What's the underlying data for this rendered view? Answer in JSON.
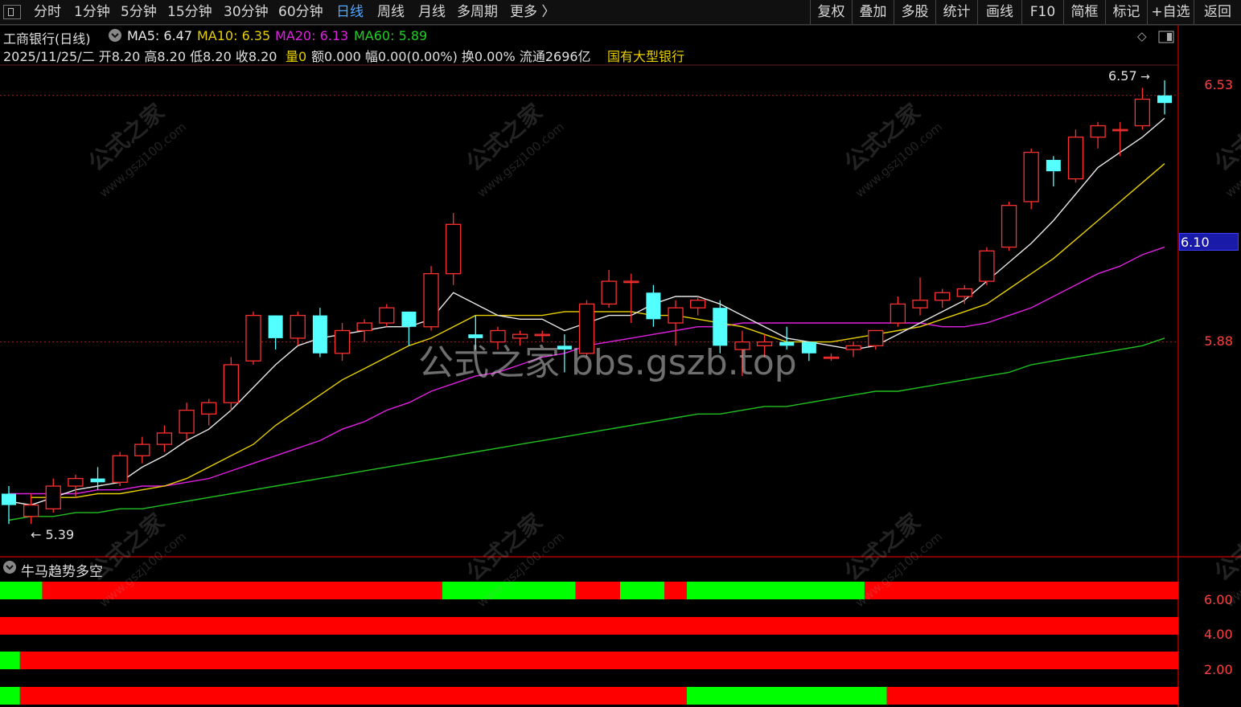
{
  "toolbar": {
    "left_items": [
      "分时",
      "1分钟",
      "5分钟",
      "15分钟",
      "30分钟",
      "60分钟",
      "日线",
      "周线",
      "月线",
      "多周期",
      "更多 〉"
    ],
    "active_index": 6,
    "right_items": [
      "复权",
      "叠加",
      "多股",
      "统计",
      "画线",
      "F10",
      "简框",
      "标记",
      "+自选",
      "返回"
    ]
  },
  "header": {
    "stock_name": "工商银行(日线)",
    "ma5": "MA5: 6.47",
    "ma10": "MA10: 6.35",
    "ma20": "MA20: 6.13",
    "ma60": "MA60: 5.89",
    "quote_line": "2025/11/25/二 开8.20 高8.20 低8.20 收8.20",
    "volume": "量0",
    "amount_etc": "额0.000 幅0.00(0.00%) 换0.00% 流通2696亿",
    "sector": "国有大型银行"
  },
  "colors": {
    "up": "#ff3030",
    "down": "#54ffff",
    "ma5": "#e8e8e8",
    "ma10": "#e8d000",
    "ma20": "#e020e0",
    "ma60": "#20c020",
    "accent": "#4fa8ff",
    "ind_red": "#ff0000",
    "ind_green": "#00ff00"
  },
  "price_axis": {
    "labels": [
      "6.53",
      "6.10",
      "5.88"
    ],
    "current_price_tag": "6.10",
    "high_marker": "6.57",
    "low_marker": "5.39"
  },
  "chart_data": {
    "type": "candlestick",
    "ylim": [
      5.32,
      6.61
    ],
    "candles": [
      [
        5.48,
        5.45,
        5.5,
        5.4
      ],
      [
        5.42,
        5.45,
        5.48,
        5.4
      ],
      [
        5.44,
        5.5,
        5.52,
        5.43
      ],
      [
        5.5,
        5.52,
        5.53,
        5.47
      ],
      [
        5.52,
        5.51,
        5.55,
        5.49
      ],
      [
        5.51,
        5.58,
        5.59,
        5.5
      ],
      [
        5.58,
        5.61,
        5.63,
        5.56
      ],
      [
        5.61,
        5.64,
        5.66,
        5.59
      ],
      [
        5.64,
        5.7,
        5.72,
        5.62
      ],
      [
        5.69,
        5.72,
        5.73,
        5.66
      ],
      [
        5.72,
        5.82,
        5.84,
        5.7
      ],
      [
        5.83,
        5.95,
        5.96,
        5.82
      ],
      [
        5.95,
        5.89,
        5.95,
        5.86
      ],
      [
        5.89,
        5.95,
        5.96,
        5.87
      ],
      [
        5.95,
        5.85,
        5.97,
        5.84
      ],
      [
        5.85,
        5.91,
        5.93,
        5.83
      ],
      [
        5.91,
        5.93,
        5.94,
        5.88
      ],
      [
        5.93,
        5.97,
        5.98,
        5.92
      ],
      [
        5.96,
        5.92,
        5.96,
        5.87
      ],
      [
        5.92,
        6.06,
        6.08,
        5.91
      ],
      [
        6.06,
        6.19,
        6.22,
        6.03
      ],
      [
        5.9,
        5.89,
        5.95,
        5.86
      ],
      [
        5.88,
        5.91,
        5.92,
        5.86
      ],
      [
        5.89,
        5.9,
        5.91,
        5.87
      ],
      [
        5.9,
        5.9,
        5.91,
        5.88
      ],
      [
        5.87,
        5.86,
        5.9,
        5.8
      ],
      [
        5.85,
        5.98,
        5.99,
        5.84
      ],
      [
        5.98,
        6.04,
        6.07,
        5.97
      ],
      [
        6.04,
        6.04,
        6.06,
        5.93
      ],
      [
        6.01,
        5.94,
        6.03,
        5.92
      ],
      [
        5.93,
        5.97,
        5.99,
        5.87
      ],
      [
        5.97,
        5.99,
        6.0,
        5.95
      ],
      [
        5.97,
        5.87,
        5.99,
        5.85
      ],
      [
        5.86,
        5.88,
        5.91,
        5.79
      ],
      [
        5.87,
        5.88,
        5.9,
        5.84
      ],
      [
        5.88,
        5.87,
        5.92,
        5.86
      ],
      [
        5.88,
        5.85,
        5.88,
        5.83
      ],
      [
        5.84,
        5.84,
        5.85,
        5.83
      ],
      [
        5.86,
        5.87,
        5.88,
        5.84
      ],
      [
        5.87,
        5.91,
        5.91,
        5.86
      ],
      [
        5.93,
        5.98,
        6.0,
        5.92
      ],
      [
        5.97,
        5.99,
        6.05,
        5.95
      ],
      [
        5.99,
        6.01,
        6.02,
        5.97
      ],
      [
        6.0,
        6.02,
        6.03,
        5.98
      ],
      [
        6.04,
        6.12,
        6.13,
        6.03
      ],
      [
        6.13,
        6.24,
        6.25,
        6.12
      ],
      [
        6.25,
        6.38,
        6.39,
        6.23
      ],
      [
        6.36,
        6.33,
        6.37,
        6.29
      ],
      [
        6.31,
        6.42,
        6.44,
        6.3
      ],
      [
        6.42,
        6.45,
        6.46,
        6.39
      ],
      [
        6.44,
        6.44,
        6.46,
        6.37
      ],
      [
        6.45,
        6.52,
        6.55,
        6.44
      ],
      [
        6.53,
        6.51,
        6.57,
        6.48
      ]
    ],
    "ma5": [
      5.46,
      5.45,
      5.47,
      5.49,
      5.5,
      5.51,
      5.55,
      5.58,
      5.62,
      5.65,
      5.7,
      5.76,
      5.82,
      5.87,
      5.89,
      5.9,
      5.91,
      5.92,
      5.92,
      5.94,
      6.01,
      5.98,
      5.95,
      5.94,
      5.94,
      5.91,
      5.93,
      5.95,
      5.95,
      5.98,
      6.0,
      6.0,
      5.98,
      5.95,
      5.92,
      5.89,
      5.88,
      5.87,
      5.86,
      5.87,
      5.9,
      5.93,
      5.96,
      5.99,
      6.04,
      6.09,
      6.14,
      6.2,
      6.27,
      6.34,
      6.38,
      6.42,
      6.47
    ],
    "ma10": [
      5.47,
      5.47,
      5.47,
      5.48,
      5.48,
      5.49,
      5.5,
      5.52,
      5.55,
      5.58,
      5.61,
      5.66,
      5.7,
      5.74,
      5.78,
      5.81,
      5.84,
      5.87,
      5.89,
      5.92,
      5.95,
      5.95,
      5.95,
      5.95,
      5.96,
      5.96,
      5.96,
      5.96,
      5.95,
      5.95,
      5.94,
      5.93,
      5.92,
      5.9,
      5.88,
      5.88,
      5.88,
      5.89,
      5.9,
      5.91,
      5.92,
      5.94,
      5.96,
      5.98,
      6.02,
      6.06,
      6.1,
      6.15,
      6.2,
      6.25,
      6.3,
      6.35
    ],
    "ma20": [
      5.48,
      5.48,
      5.48,
      5.48,
      5.49,
      5.49,
      5.5,
      5.5,
      5.51,
      5.52,
      5.54,
      5.56,
      5.58,
      5.6,
      5.62,
      5.65,
      5.67,
      5.7,
      5.72,
      5.75,
      5.77,
      5.79,
      5.8,
      5.82,
      5.84,
      5.85,
      5.87,
      5.88,
      5.89,
      5.9,
      5.91,
      5.92,
      5.92,
      5.93,
      5.93,
      5.93,
      5.93,
      5.93,
      5.93,
      5.93,
      5.93,
      5.93,
      5.92,
      5.92,
      5.93,
      5.95,
      5.97,
      6.0,
      6.03,
      6.06,
      6.08,
      6.11,
      6.13
    ],
    "ma60": [
      5.41,
      5.42,
      5.42,
      5.43,
      5.43,
      5.44,
      5.44,
      5.45,
      5.46,
      5.47,
      5.48,
      5.49,
      5.5,
      5.51,
      5.52,
      5.53,
      5.54,
      5.55,
      5.56,
      5.57,
      5.58,
      5.59,
      5.6,
      5.61,
      5.62,
      5.63,
      5.64,
      5.65,
      5.66,
      5.67,
      5.68,
      5.69,
      5.69,
      5.7,
      5.71,
      5.71,
      5.72,
      5.73,
      5.74,
      5.75,
      5.75,
      5.76,
      5.77,
      5.78,
      5.79,
      5.8,
      5.82,
      5.83,
      5.84,
      5.85,
      5.86,
      5.87,
      5.89
    ]
  },
  "indicator": {
    "name": "牛马趋势多空",
    "axis_labels": [
      "6.00",
      "4.00",
      "2.00"
    ],
    "rows": [
      [
        [
          "g",
          0,
          2
        ],
        [
          "r",
          2,
          20
        ],
        [
          "g",
          20,
          26
        ],
        [
          "r",
          26,
          28
        ],
        [
          "g",
          28,
          30
        ],
        [
          "r",
          30,
          31
        ],
        [
          "g",
          31,
          39
        ],
        [
          "r",
          39,
          53
        ]
      ],
      [
        [
          "r",
          0,
          53
        ]
      ],
      [
        [
          "g",
          0,
          1
        ],
        [
          "r",
          1,
          53
        ]
      ],
      [
        [
          "g",
          0,
          1
        ],
        [
          "r",
          1,
          31
        ],
        [
          "g",
          31,
          40
        ],
        [
          "r",
          40,
          53
        ]
      ]
    ]
  },
  "watermark": {
    "text": "公式之家",
    "site": "www.gszj100.com",
    "center": "公式之家 bbs.gszb.top"
  }
}
